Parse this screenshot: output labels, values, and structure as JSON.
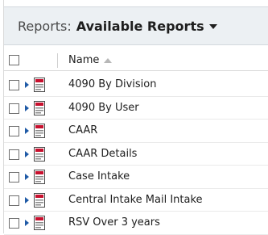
{
  "header": {
    "prefix": "Reports:",
    "view_name": "Available Reports"
  },
  "columns": {
    "name": "Name"
  },
  "rows": [
    {
      "name": "4090 By Division"
    },
    {
      "name": "4090 By User"
    },
    {
      "name": "CAAR"
    },
    {
      "name": "CAAR Details"
    },
    {
      "name": "Case Intake"
    },
    {
      "name": "Central Intake Mail Intake"
    },
    {
      "name": "RSV Over 3 years"
    }
  ],
  "icons": {
    "row_expand": "expand-arrow-icon",
    "row_type": "report-icon",
    "sort": "sort-ascending-icon",
    "view_selector": "chevron-down-icon"
  },
  "colors": {
    "header_bg": "#ecf0f3",
    "expand_arrow": "#1f5aa6",
    "report_icon_red": "#c8102e"
  }
}
